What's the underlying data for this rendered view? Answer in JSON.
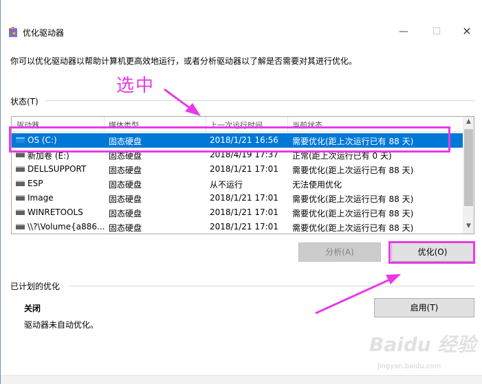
{
  "window": {
    "title": "优化驱动器",
    "minimize_glyph": "—",
    "maximize_glyph": "☐",
    "close_glyph": "✕"
  },
  "intro_text": "你可以优化驱动器以帮助计算机更高效地运行，或者分析驱动器以了解是否需要对其进行优化。",
  "status_section": {
    "label": "状态(T)",
    "columns": [
      "驱动器",
      "媒体类型",
      "上一次运行时间",
      "当前状态"
    ],
    "rows": [
      {
        "drive": "OS (C:)",
        "media": "固态硬盘",
        "last_run": "2018/1/21 16:56",
        "status": "需要优化(距上次运行已有 88 天)",
        "icon": "windows-drive-icon",
        "selected": true
      },
      {
        "drive": "新加卷 (E:)",
        "media": "固态硬盘",
        "last_run": "2018/4/19 17:37",
        "status": "正常(距上次运行已有 0 天)",
        "icon": "drive-icon",
        "selected": false
      },
      {
        "drive": "DELLSUPPORT",
        "media": "固态硬盘",
        "last_run": "2018/1/21 17:01",
        "status": "需要优化(距上次运行已有 88 天)",
        "icon": "drive-icon",
        "selected": false
      },
      {
        "drive": "ESP",
        "media": "固态硬盘",
        "last_run": "从不运行",
        "status": "无法使用优化",
        "icon": "drive-icon",
        "selected": false
      },
      {
        "drive": "Image",
        "media": "固态硬盘",
        "last_run": "2018/1/21 17:01",
        "status": "需要优化(距上次运行已有 88 天)",
        "icon": "drive-icon",
        "selected": false
      },
      {
        "drive": "WINRETOOLS",
        "media": "固态硬盘",
        "last_run": "2018/1/21 17:01",
        "status": "需要优化(距上次运行已有 88 天)",
        "icon": "drive-icon",
        "selected": false
      },
      {
        "drive": "\\\\?\\Volume{a886...",
        "media": "固态硬盘",
        "last_run": "2018/1/21 17:01",
        "status": "需要优化(距上次运行已有 88 天)",
        "icon": "drive-icon",
        "selected": false
      }
    ]
  },
  "buttons": {
    "analyze": "分析(A)",
    "optimize": "优化(O)",
    "enable": "启用(T)"
  },
  "scheduled_section": {
    "label": "已计划的优化",
    "title": "关闭",
    "description": "驱动器未自动优化。"
  },
  "annotation": {
    "label": "选中",
    "color": "#e83ae8"
  },
  "watermark": {
    "text": "Baidu 经验",
    "sub": "jingyan.baidu.com"
  },
  "colors": {
    "selection": "#0078d7",
    "annotation": "#e83ae8"
  }
}
